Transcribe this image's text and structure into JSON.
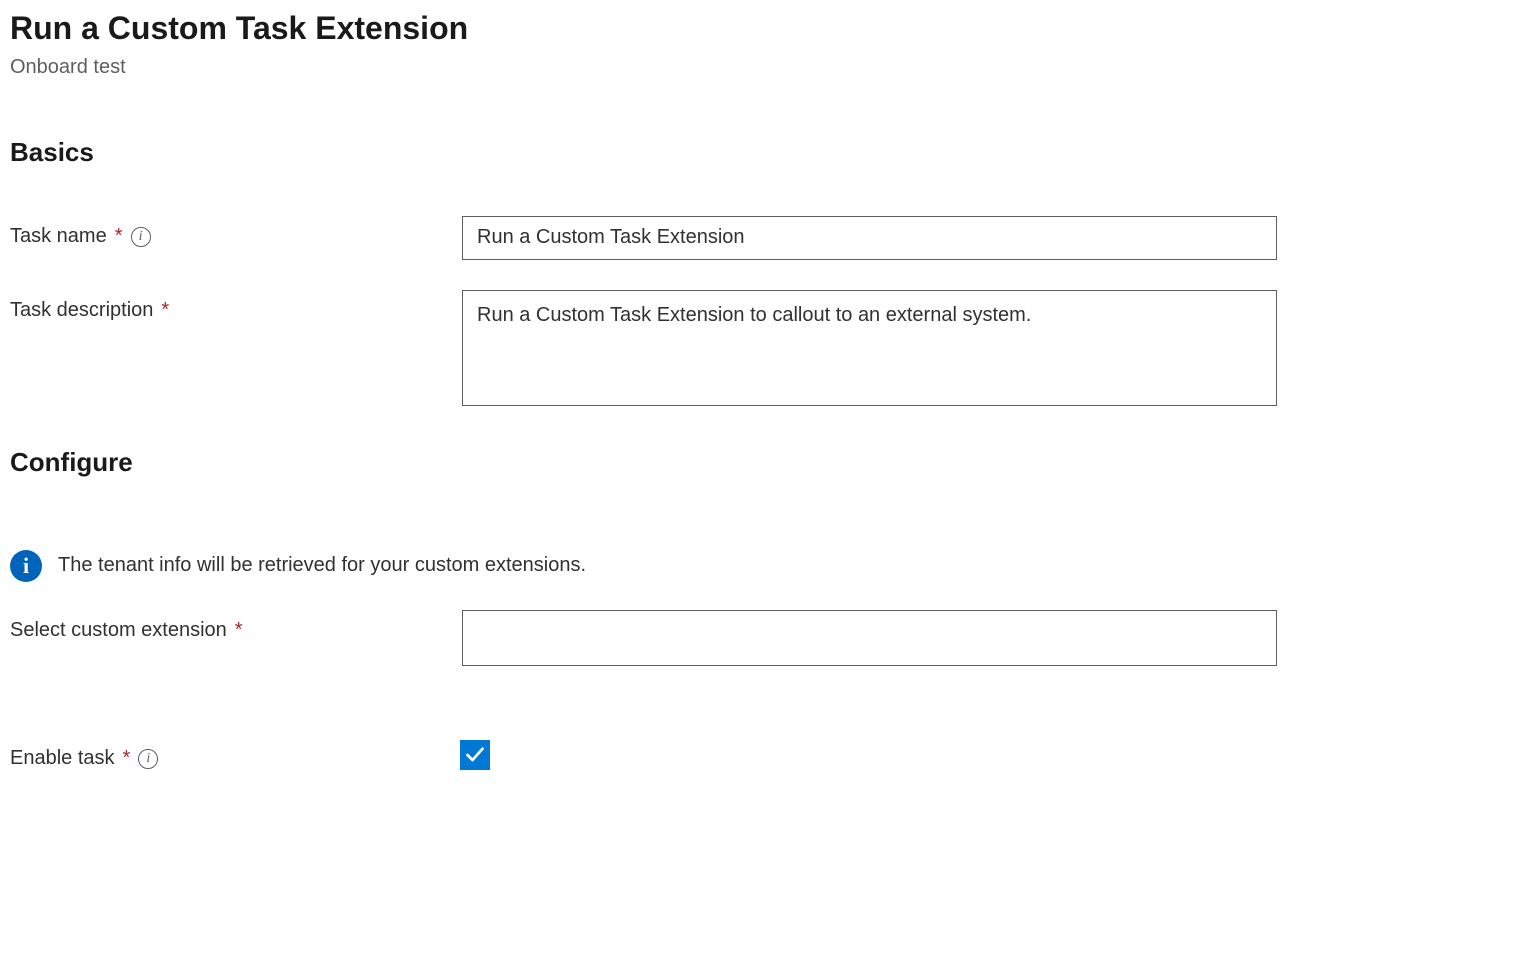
{
  "page": {
    "title": "Run a Custom Task Extension",
    "subtitle": "Onboard test"
  },
  "sections": {
    "basics": {
      "heading": "Basics",
      "taskName": {
        "label": "Task name",
        "required": "*",
        "value": "Run a Custom Task Extension"
      },
      "taskDescription": {
        "label": "Task description",
        "required": "*",
        "value": "Run a Custom Task Extension to callout to an external system."
      }
    },
    "configure": {
      "heading": "Configure",
      "infoText": "The tenant info will be retrieved for your custom extensions.",
      "selectExtension": {
        "label": "Select custom extension",
        "required": "*",
        "value": ""
      },
      "enableTask": {
        "label": "Enable task",
        "required": "*",
        "checked": true
      }
    }
  }
}
